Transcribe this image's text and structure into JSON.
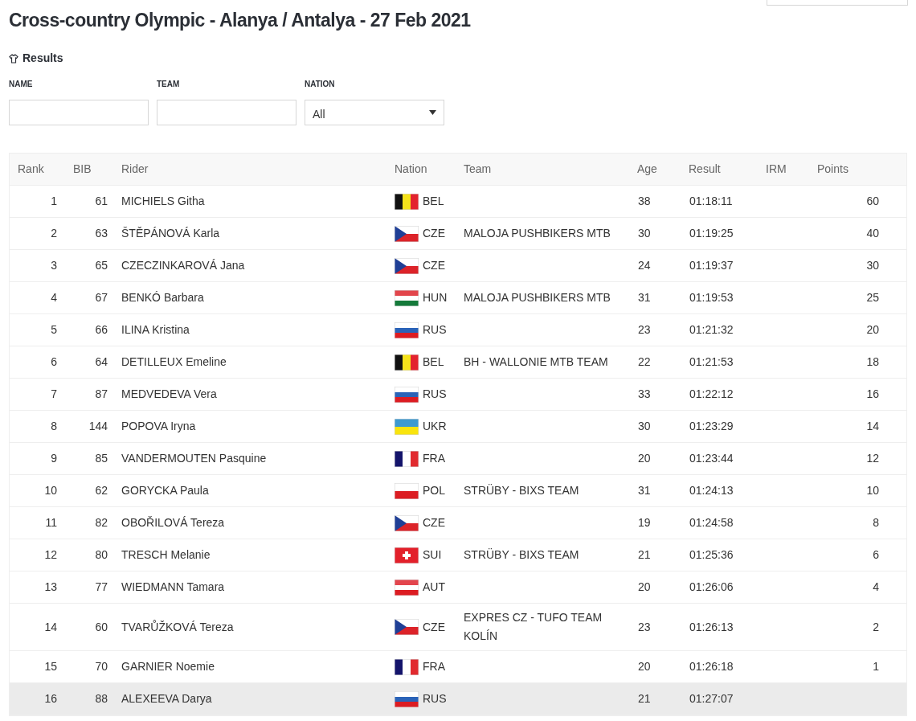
{
  "title": "Cross-country Olympic - Alanya / Antalya - 27 Feb 2021",
  "section": {
    "label": "Results"
  },
  "filters": [
    {
      "kind": "text",
      "label": "NAME"
    },
    {
      "kind": "text",
      "label": "TEAM"
    },
    {
      "kind": "select",
      "label": "NATION",
      "value": "All"
    }
  ],
  "table": {
    "columns": [
      "Rank",
      "BIB",
      "Rider",
      "Nation",
      "Team",
      "Age",
      "Result",
      "IRM",
      "Points"
    ],
    "rows": [
      {
        "rank": "1",
        "bib": "61",
        "rider": "MICHIELS Githa",
        "kind": "bel",
        "nation": "BEL",
        "age": "38",
        "result": "01:18:11",
        "points": "60",
        "highlighted": false
      },
      {
        "rank": "2",
        "bib": "63",
        "rider": "ŠTĚPÁNOVÁ Karla",
        "kind": "cze",
        "nation": "CZE",
        "team": "MALOJA PUSHBIKERS MTB",
        "age": "30",
        "result": "01:19:25",
        "points": "40",
        "highlighted": false
      },
      {
        "rank": "3",
        "bib": "65",
        "rider": "CZECZINKAROVÁ Jana",
        "kind": "cze",
        "nation": "CZE",
        "age": "24",
        "result": "01:19:37",
        "points": "30",
        "highlighted": false
      },
      {
        "rank": "4",
        "bib": "67",
        "rider": "BENKÓ Barbara",
        "kind": "hun",
        "nation": "HUN",
        "team": "MALOJA PUSHBIKERS MTB",
        "age": "31",
        "result": "01:19:53",
        "points": "25",
        "highlighted": false
      },
      {
        "rank": "5",
        "bib": "66",
        "rider": "ILINA Kristina",
        "kind": "rus",
        "nation": "RUS",
        "age": "23",
        "result": "01:21:32",
        "points": "20",
        "highlighted": false
      },
      {
        "rank": "6",
        "bib": "64",
        "rider": "DETILLEUX Emeline",
        "kind": "bel",
        "nation": "BEL",
        "team": "BH - WALLONIE MTB TEAM",
        "age": "22",
        "result": "01:21:53",
        "points": "18",
        "highlighted": false
      },
      {
        "rank": "7",
        "bib": "87",
        "rider": "MEDVEDEVA Vera",
        "kind": "rus",
        "nation": "RUS",
        "age": "33",
        "result": "01:22:12",
        "points": "16",
        "highlighted": false
      },
      {
        "rank": "8",
        "bib": "144",
        "rider": "POPOVA Iryna",
        "kind": "ukr",
        "nation": "UKR",
        "age": "30",
        "result": "01:23:29",
        "points": "14",
        "highlighted": false
      },
      {
        "rank": "9",
        "bib": "85",
        "rider": "VANDERMOUTEN Pasquine",
        "kind": "fra",
        "nation": "FRA",
        "age": "20",
        "result": "01:23:44",
        "points": "12",
        "highlighted": false
      },
      {
        "rank": "10",
        "bib": "62",
        "rider": "GORYCKA Paula",
        "kind": "pol",
        "nation": "POL",
        "team": "STRÜBY - BIXS TEAM",
        "age": "31",
        "result": "01:24:13",
        "points": "10",
        "highlighted": false
      },
      {
        "rank": "11",
        "bib": "82",
        "rider": "OBOŘILOVÁ Tereza",
        "kind": "cze",
        "nation": "CZE",
        "age": "19",
        "result": "01:24:58",
        "points": "8",
        "highlighted": false
      },
      {
        "rank": "12",
        "bib": "80",
        "rider": "TRESCH Melanie",
        "kind": "sui",
        "nation": "SUI",
        "team": "STRÜBY - BIXS TEAM",
        "age": "21",
        "result": "01:25:36",
        "points": "6",
        "highlighted": false
      },
      {
        "rank": "13",
        "bib": "77",
        "rider": "WIEDMANN Tamara",
        "kind": "aut",
        "nation": "AUT",
        "age": "20",
        "result": "01:26:06",
        "points": "4",
        "highlighted": false
      },
      {
        "rank": "14",
        "bib": "60",
        "rider": "TVARŮŽKOVÁ Tereza",
        "kind": "cze",
        "nation": "CZE",
        "team": "EXPRES CZ - TUFO TEAM KOLÍN",
        "age": "23",
        "result": "01:26:13",
        "points": "2",
        "highlighted": false
      },
      {
        "rank": "15",
        "bib": "70",
        "rider": "GARNIER Noemie",
        "kind": "fra",
        "nation": "FRA",
        "age": "20",
        "result": "01:26:18",
        "points": "1",
        "highlighted": false
      },
      {
        "rank": "16",
        "bib": "88",
        "rider": "ALEXEEVA Darya",
        "kind": "rus",
        "nation": "RUS",
        "age": "21",
        "result": "01:27:07",
        "highlighted": true
      }
    ]
  }
}
